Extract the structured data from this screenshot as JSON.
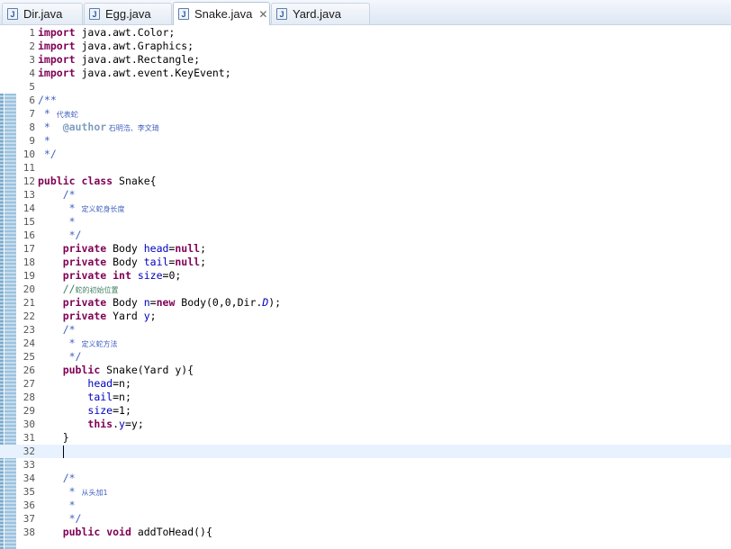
{
  "tabs": [
    {
      "label": "Dir.java",
      "active": false
    },
    {
      "label": "Egg.java",
      "active": false
    },
    {
      "label": "Snake.java",
      "active": true,
      "close": "✕"
    },
    {
      "label": "Yard.java",
      "active": false
    }
  ],
  "icon_letter": "J",
  "lines": {
    "l1": {
      "n": "1",
      "t": [
        [
          "kw",
          "import"
        ],
        [
          "",
          "java.awt.Color;"
        ]
      ]
    },
    "l2": {
      "n": "2",
      "t": [
        [
          "kw",
          "import"
        ],
        [
          "",
          "java.awt.Graphics;"
        ]
      ]
    },
    "l3": {
      "n": "3",
      "t": [
        [
          "kw",
          "import"
        ],
        [
          "",
          "java.awt.Rectangle;"
        ]
      ]
    },
    "l4": {
      "n": "4",
      "t": [
        [
          "kw",
          "import"
        ],
        [
          "",
          "java.awt.event.KeyEvent;"
        ]
      ]
    }
  },
  "code": {
    "l1_kw": "import",
    "l1_rest": " java.awt.Color;",
    "l2_kw": "import",
    "l2_rest": " java.awt.Graphics;",
    "l3_kw": "import",
    "l3_rest": " java.awt.Rectangle;",
    "l4_kw": "import",
    "l4_rest": " java.awt.event.KeyEvent;",
    "l6": "/**",
    "l7_star": " * ",
    "l7_txt": "代表蛇",
    "l8_star": " *  ",
    "l8_an": "@author",
    "l8_txt": " 石明浩、李文琦",
    "l9": " *",
    "l10": " */",
    "l12_kw1": "public",
    "l12_kw2": "class",
    "l12_rest": " Snake{",
    "l13": "    /*",
    "l14_star": "     * ",
    "l14_txt": "定义蛇身长度",
    "l15": "     *",
    "l16": "     */",
    "l17_kw": "private",
    "l17_a": " Body ",
    "l17_f": "head",
    "l17_b": "=",
    "l17_kw2": "null",
    "l17_c": ";",
    "l18_kw": "private",
    "l18_a": " Body ",
    "l18_f": "tail",
    "l18_b": "=",
    "l18_kw2": "null",
    "l18_c": ";",
    "l19_kw": "private",
    "l19_kw2": "int",
    "l19_f": "size",
    "l19_b": "=0;",
    "l20_c": "    //",
    "l20_txt": "蛇的初始位置",
    "l21_kw": "private",
    "l21_a": " Body ",
    "l21_f": "n",
    "l21_b": "=",
    "l21_kw2": "new",
    "l21_c": " Body(0,0,Dir.",
    "l21_st": "D",
    "l21_d": ");",
    "l22_kw": "private",
    "l22_a": " Yard ",
    "l22_f": "y",
    "l22_b": ";",
    "l23": "    /*",
    "l24_star": "     * ",
    "l24_txt": "定义蛇方法",
    "l25": "     */",
    "l26_kw": "public",
    "l26_rest": " Snake(Yard y){",
    "l27_f": "head",
    "l27_b": "=n;",
    "l28_f": "tail",
    "l28_b": "=n;",
    "l29_f": "size",
    "l29_b": "=1;",
    "l30_kw": "this",
    "l30_a": ".",
    "l30_f": "y",
    "l30_b": "=y;",
    "l31": "    }",
    "l34": "    /*",
    "l35_star": "     * ",
    "l35_txt": "从头加1",
    "l36": "     *",
    "l37": "     */",
    "l38_kw1": "public",
    "l38_kw2": "void",
    "l38_rest": " addToHead(){"
  }
}
